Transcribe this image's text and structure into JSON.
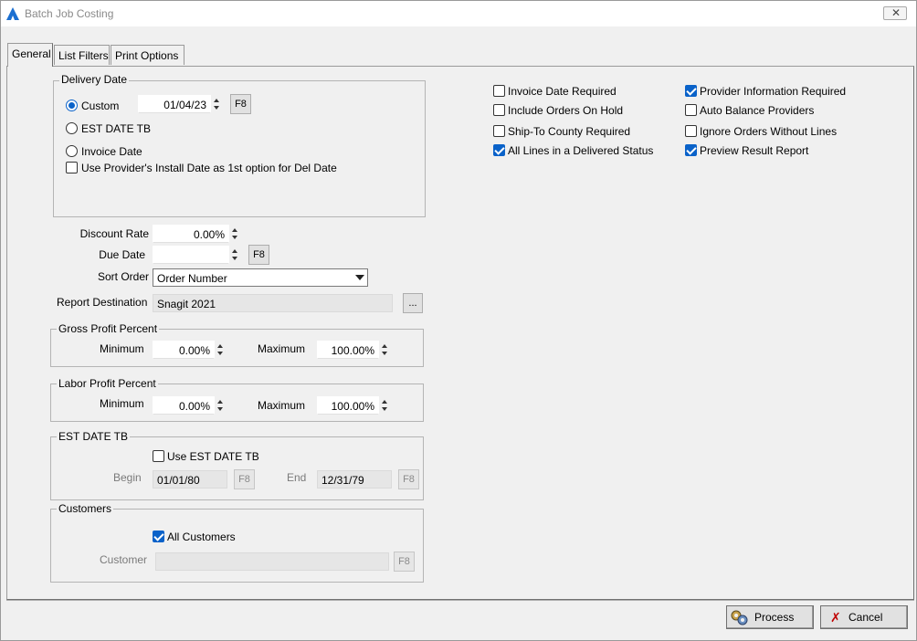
{
  "window": {
    "title": "Batch Job Costing"
  },
  "tabs": [
    {
      "label": "General",
      "active": true
    },
    {
      "label": "List Filters",
      "active": false
    },
    {
      "label": "Print Options",
      "active": false
    }
  ],
  "delivery_date": {
    "group_label": "Delivery Date",
    "custom_label": "Custom",
    "custom_selected": true,
    "custom_value": "01/04/23",
    "f8_label": "F8",
    "est_label": "EST DATE TB",
    "invoice_label": "Invoice Date",
    "use_provider_label": "Use Provider's Install Date as 1st option for Del Date",
    "use_provider_checked": false
  },
  "options": [
    {
      "label": "Invoice Date Required",
      "checked": false
    },
    {
      "label": "Include Orders On Hold",
      "checked": false
    },
    {
      "label": "Ship-To County Required",
      "checked": false
    },
    {
      "label": "All Lines in a Delivered Status",
      "checked": true
    },
    {
      "label": "Provider Information Required",
      "checked": true
    },
    {
      "label": "Auto Balance Providers",
      "checked": false
    },
    {
      "label": "Ignore Orders Without  Lines",
      "checked": false
    },
    {
      "label": "Preview Result Report",
      "checked": true
    }
  ],
  "form": {
    "discount_rate_label": "Discount Rate",
    "discount_rate_value": "0.00%",
    "due_date_label": "Due Date",
    "due_date_value": "",
    "f8_label": "F8",
    "sort_order_label": "Sort Order",
    "sort_order_value": "Order Number",
    "report_destination_label": "Report Destination",
    "report_destination_value": "Snagit 2021",
    "browse_label": "..."
  },
  "gross_profit": {
    "group_label": "Gross Profit Percent",
    "min_label": "Minimum",
    "min_value": "0.00%",
    "max_label": "Maximum",
    "max_value": "100.00%"
  },
  "labor_profit": {
    "group_label": "Labor Profit Percent",
    "min_label": "Minimum",
    "min_value": "0.00%",
    "max_label": "Maximum",
    "max_value": "100.00%"
  },
  "est_date": {
    "group_label": "EST DATE TB",
    "use_label": "Use EST DATE TB",
    "use_checked": false,
    "begin_label": "Begin",
    "begin_value": "01/01/80",
    "end_label": "End",
    "end_value": "12/31/79",
    "f8_label": "F8"
  },
  "customers": {
    "group_label": "Customers",
    "all_label": "All Customers",
    "all_checked": true,
    "customer_label": "Customer",
    "customer_value": "",
    "f8_label": "F8"
  },
  "footer": {
    "process_label": "Process",
    "cancel_label": "Cancel"
  },
  "colors": {
    "accent": "#0a62c9",
    "cancel_icon": "#c00000"
  }
}
